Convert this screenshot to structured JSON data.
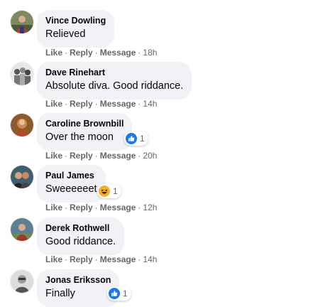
{
  "actions": {
    "like": "Like",
    "reply": "Reply",
    "message": "Message",
    "separator": "·"
  },
  "colors": {
    "bubble_bg": "#f0f2f5",
    "meta_text": "#65676b",
    "like_blue": "#1877f2",
    "haha_yellow": "#f7b125"
  },
  "comments": [
    {
      "author": "Vince Dowling",
      "text": "Relieved",
      "time": "18h"
    },
    {
      "author": "Dave Rinehart",
      "text": "Absolute diva. Good riddance.",
      "time": "14h"
    },
    {
      "author": "Caroline Brownbill",
      "text": "Over the moon",
      "time": "20h",
      "reaction": {
        "icon": "like-icon",
        "count": "1"
      }
    },
    {
      "author": "Paul James",
      "text": "Sweeeeeet",
      "time": "12h",
      "reaction": {
        "icon": "haha-icon",
        "count": "1"
      }
    },
    {
      "author": "Derek Rothwell",
      "text": "Good riddance.",
      "time": "14h"
    },
    {
      "author": "Jonas Eriksson",
      "text": "Finally",
      "reaction": {
        "icon": "like-icon",
        "count": "1"
      }
    }
  ]
}
